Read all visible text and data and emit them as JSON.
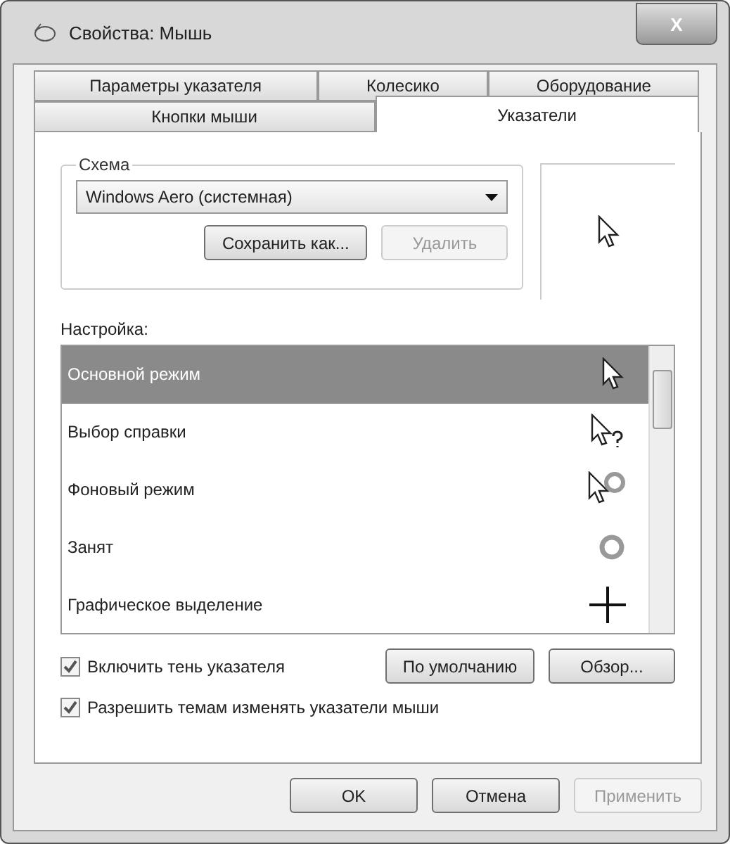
{
  "window": {
    "title": "Свойства: Мышь",
    "close": "X"
  },
  "tab_rows": [
    [
      {
        "label": "Параметры указателя",
        "selected": false
      },
      {
        "label": "Колесико",
        "selected": false
      },
      {
        "label": "Оборудование",
        "selected": false
      }
    ],
    [
      {
        "label": "Кнопки мыши",
        "selected": false
      },
      {
        "label": "Указатели",
        "selected": true
      }
    ]
  ],
  "scheme": {
    "label": "Схема",
    "value": "Windows Aero (системная)",
    "buttons": [
      {
        "label": "Сохранить как...",
        "disabled": false
      },
      {
        "label": "Удалить",
        "disabled": true
      }
    ]
  },
  "customize": {
    "label": "Настройка:",
    "items": [
      {
        "label": "Основной режим",
        "kind": "arrow",
        "selected": true
      },
      {
        "label": "Выбор справки",
        "kind": "help",
        "selected": false
      },
      {
        "label": "Фоновый режим",
        "kind": "working",
        "selected": false
      },
      {
        "label": "Занят",
        "kind": "busy",
        "selected": false
      },
      {
        "label": "Графическое выделение",
        "kind": "cross",
        "selected": false
      }
    ]
  },
  "options": [
    {
      "label": "Включить тень указателя",
      "checked": true
    },
    {
      "label": "Разрешить темам изменять указатели мыши",
      "checked": true
    }
  ],
  "list_buttons": [
    {
      "label": "По умолчанию",
      "disabled": false
    },
    {
      "label": "Обзор...",
      "disabled": false
    }
  ],
  "footer_buttons": [
    {
      "label": "OK",
      "disabled": false
    },
    {
      "label": "Отмена",
      "disabled": false
    },
    {
      "label": "Применить",
      "disabled": true
    }
  ]
}
